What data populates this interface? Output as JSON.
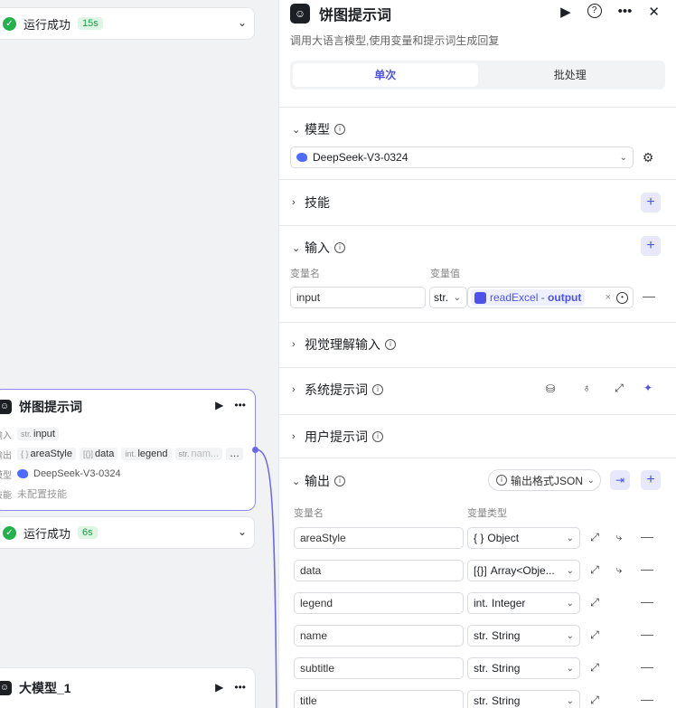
{
  "canvas": {
    "run1": {
      "label": "运行成功",
      "time": "15s"
    },
    "node": {
      "title": "饼图提示词",
      "input_label": "输入",
      "input_type": "str.",
      "input_value": "input",
      "output_label": "输出",
      "outputs": [
        {
          "type": "{ }",
          "name": "areaStyle"
        },
        {
          "type": "[{}]",
          "name": "data"
        },
        {
          "type": "int.",
          "name": "legend"
        },
        {
          "type": "str.",
          "name": "nam..."
        }
      ],
      "model_label": "模型",
      "model_value": "DeepSeek-V3-0324",
      "skill_label": "技能",
      "skill_value": "未配置技能"
    },
    "run2": {
      "label": "运行成功",
      "time": "6s"
    },
    "node2": {
      "title": "大模型_1"
    }
  },
  "panel": {
    "title": "饼图提示词",
    "description": "调用大语言模型,使用变量和提示词生成回复",
    "tabs": [
      "单次",
      "批处理"
    ],
    "model": {
      "label": "模型",
      "value": "DeepSeek-V3-0324"
    },
    "skills": {
      "label": "技能"
    },
    "inputs": {
      "label": "输入",
      "col_name": "变量名",
      "col_value": "变量值",
      "row": {
        "name": "input",
        "type": "str.",
        "ref_node": "readExcel",
        "ref_sep": " - ",
        "ref_var": "output"
      }
    },
    "vision": {
      "label": "视觉理解输入"
    },
    "system_prompt": {
      "label": "系统提示词"
    },
    "user_prompt": {
      "label": "用户提示词"
    },
    "outputs": {
      "label": "输出",
      "format": "输出格式JSON",
      "col_name": "变量名",
      "col_type": "变量类型",
      "rows": [
        {
          "name": "areaStyle",
          "type_icon": "{ }",
          "type": "Object",
          "child": true
        },
        {
          "name": "data",
          "type_icon": "[{}]",
          "type": "Array<Obje...",
          "child": true
        },
        {
          "name": "legend",
          "type_icon": "int.",
          "type": "Integer",
          "child": false
        },
        {
          "name": "name",
          "type_icon": "str.",
          "type": "String",
          "child": false
        },
        {
          "name": "subtitle",
          "type_icon": "str.",
          "type": "String",
          "child": false
        },
        {
          "name": "title",
          "type_icon": "str.",
          "type": "String",
          "child": false
        }
      ]
    }
  }
}
